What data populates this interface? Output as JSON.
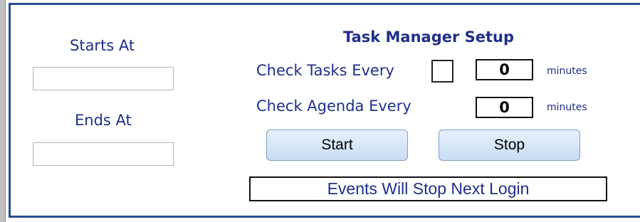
{
  "left": {
    "starts_label": "Starts At",
    "starts_value": "",
    "ends_label": "Ends At",
    "ends_value": ""
  },
  "setup": {
    "title": "Task Manager Setup",
    "tasks_label": "Check Tasks Every",
    "tasks_checked": false,
    "tasks_value": "0",
    "tasks_unit": "minutes",
    "agenda_label": "Check Agenda Every",
    "agenda_value": "0",
    "agenda_unit": "minutes"
  },
  "buttons": {
    "start_label": "Start",
    "stop_label": "Stop"
  },
  "status_text": "Events Will Stop Next Login",
  "colors": {
    "label_blue": "#1f2f8a",
    "panel_border": "#2a4d8f",
    "button_fill": "#c9dcf3"
  }
}
